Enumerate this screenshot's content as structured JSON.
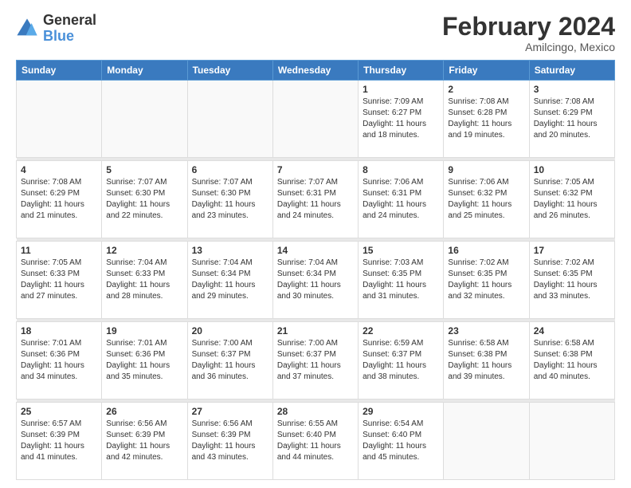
{
  "logo": {
    "text_general": "General",
    "text_blue": "Blue"
  },
  "header": {
    "title": "February 2024",
    "subtitle": "Amilcingo, Mexico"
  },
  "weekdays": [
    "Sunday",
    "Monday",
    "Tuesday",
    "Wednesday",
    "Thursday",
    "Friday",
    "Saturday"
  ],
  "weeks": [
    {
      "days": [
        {
          "num": "",
          "info": ""
        },
        {
          "num": "",
          "info": ""
        },
        {
          "num": "",
          "info": ""
        },
        {
          "num": "",
          "info": ""
        },
        {
          "num": "1",
          "info": "Sunrise: 7:09 AM\nSunset: 6:27 PM\nDaylight: 11 hours\nand 18 minutes."
        },
        {
          "num": "2",
          "info": "Sunrise: 7:08 AM\nSunset: 6:28 PM\nDaylight: 11 hours\nand 19 minutes."
        },
        {
          "num": "3",
          "info": "Sunrise: 7:08 AM\nSunset: 6:29 PM\nDaylight: 11 hours\nand 20 minutes."
        }
      ]
    },
    {
      "days": [
        {
          "num": "4",
          "info": "Sunrise: 7:08 AM\nSunset: 6:29 PM\nDaylight: 11 hours\nand 21 minutes."
        },
        {
          "num": "5",
          "info": "Sunrise: 7:07 AM\nSunset: 6:30 PM\nDaylight: 11 hours\nand 22 minutes."
        },
        {
          "num": "6",
          "info": "Sunrise: 7:07 AM\nSunset: 6:30 PM\nDaylight: 11 hours\nand 23 minutes."
        },
        {
          "num": "7",
          "info": "Sunrise: 7:07 AM\nSunset: 6:31 PM\nDaylight: 11 hours\nand 24 minutes."
        },
        {
          "num": "8",
          "info": "Sunrise: 7:06 AM\nSunset: 6:31 PM\nDaylight: 11 hours\nand 24 minutes."
        },
        {
          "num": "9",
          "info": "Sunrise: 7:06 AM\nSunset: 6:32 PM\nDaylight: 11 hours\nand 25 minutes."
        },
        {
          "num": "10",
          "info": "Sunrise: 7:05 AM\nSunset: 6:32 PM\nDaylight: 11 hours\nand 26 minutes."
        }
      ]
    },
    {
      "days": [
        {
          "num": "11",
          "info": "Sunrise: 7:05 AM\nSunset: 6:33 PM\nDaylight: 11 hours\nand 27 minutes."
        },
        {
          "num": "12",
          "info": "Sunrise: 7:04 AM\nSunset: 6:33 PM\nDaylight: 11 hours\nand 28 minutes."
        },
        {
          "num": "13",
          "info": "Sunrise: 7:04 AM\nSunset: 6:34 PM\nDaylight: 11 hours\nand 29 minutes."
        },
        {
          "num": "14",
          "info": "Sunrise: 7:04 AM\nSunset: 6:34 PM\nDaylight: 11 hours\nand 30 minutes."
        },
        {
          "num": "15",
          "info": "Sunrise: 7:03 AM\nSunset: 6:35 PM\nDaylight: 11 hours\nand 31 minutes."
        },
        {
          "num": "16",
          "info": "Sunrise: 7:02 AM\nSunset: 6:35 PM\nDaylight: 11 hours\nand 32 minutes."
        },
        {
          "num": "17",
          "info": "Sunrise: 7:02 AM\nSunset: 6:35 PM\nDaylight: 11 hours\nand 33 minutes."
        }
      ]
    },
    {
      "days": [
        {
          "num": "18",
          "info": "Sunrise: 7:01 AM\nSunset: 6:36 PM\nDaylight: 11 hours\nand 34 minutes."
        },
        {
          "num": "19",
          "info": "Sunrise: 7:01 AM\nSunset: 6:36 PM\nDaylight: 11 hours\nand 35 minutes."
        },
        {
          "num": "20",
          "info": "Sunrise: 7:00 AM\nSunset: 6:37 PM\nDaylight: 11 hours\nand 36 minutes."
        },
        {
          "num": "21",
          "info": "Sunrise: 7:00 AM\nSunset: 6:37 PM\nDaylight: 11 hours\nand 37 minutes."
        },
        {
          "num": "22",
          "info": "Sunrise: 6:59 AM\nSunset: 6:37 PM\nDaylight: 11 hours\nand 38 minutes."
        },
        {
          "num": "23",
          "info": "Sunrise: 6:58 AM\nSunset: 6:38 PM\nDaylight: 11 hours\nand 39 minutes."
        },
        {
          "num": "24",
          "info": "Sunrise: 6:58 AM\nSunset: 6:38 PM\nDaylight: 11 hours\nand 40 minutes."
        }
      ]
    },
    {
      "days": [
        {
          "num": "25",
          "info": "Sunrise: 6:57 AM\nSunset: 6:39 PM\nDaylight: 11 hours\nand 41 minutes."
        },
        {
          "num": "26",
          "info": "Sunrise: 6:56 AM\nSunset: 6:39 PM\nDaylight: 11 hours\nand 42 minutes."
        },
        {
          "num": "27",
          "info": "Sunrise: 6:56 AM\nSunset: 6:39 PM\nDaylight: 11 hours\nand 43 minutes."
        },
        {
          "num": "28",
          "info": "Sunrise: 6:55 AM\nSunset: 6:40 PM\nDaylight: 11 hours\nand 44 minutes."
        },
        {
          "num": "29",
          "info": "Sunrise: 6:54 AM\nSunset: 6:40 PM\nDaylight: 11 hours\nand 45 minutes."
        },
        {
          "num": "",
          "info": ""
        },
        {
          "num": "",
          "info": ""
        }
      ]
    }
  ]
}
